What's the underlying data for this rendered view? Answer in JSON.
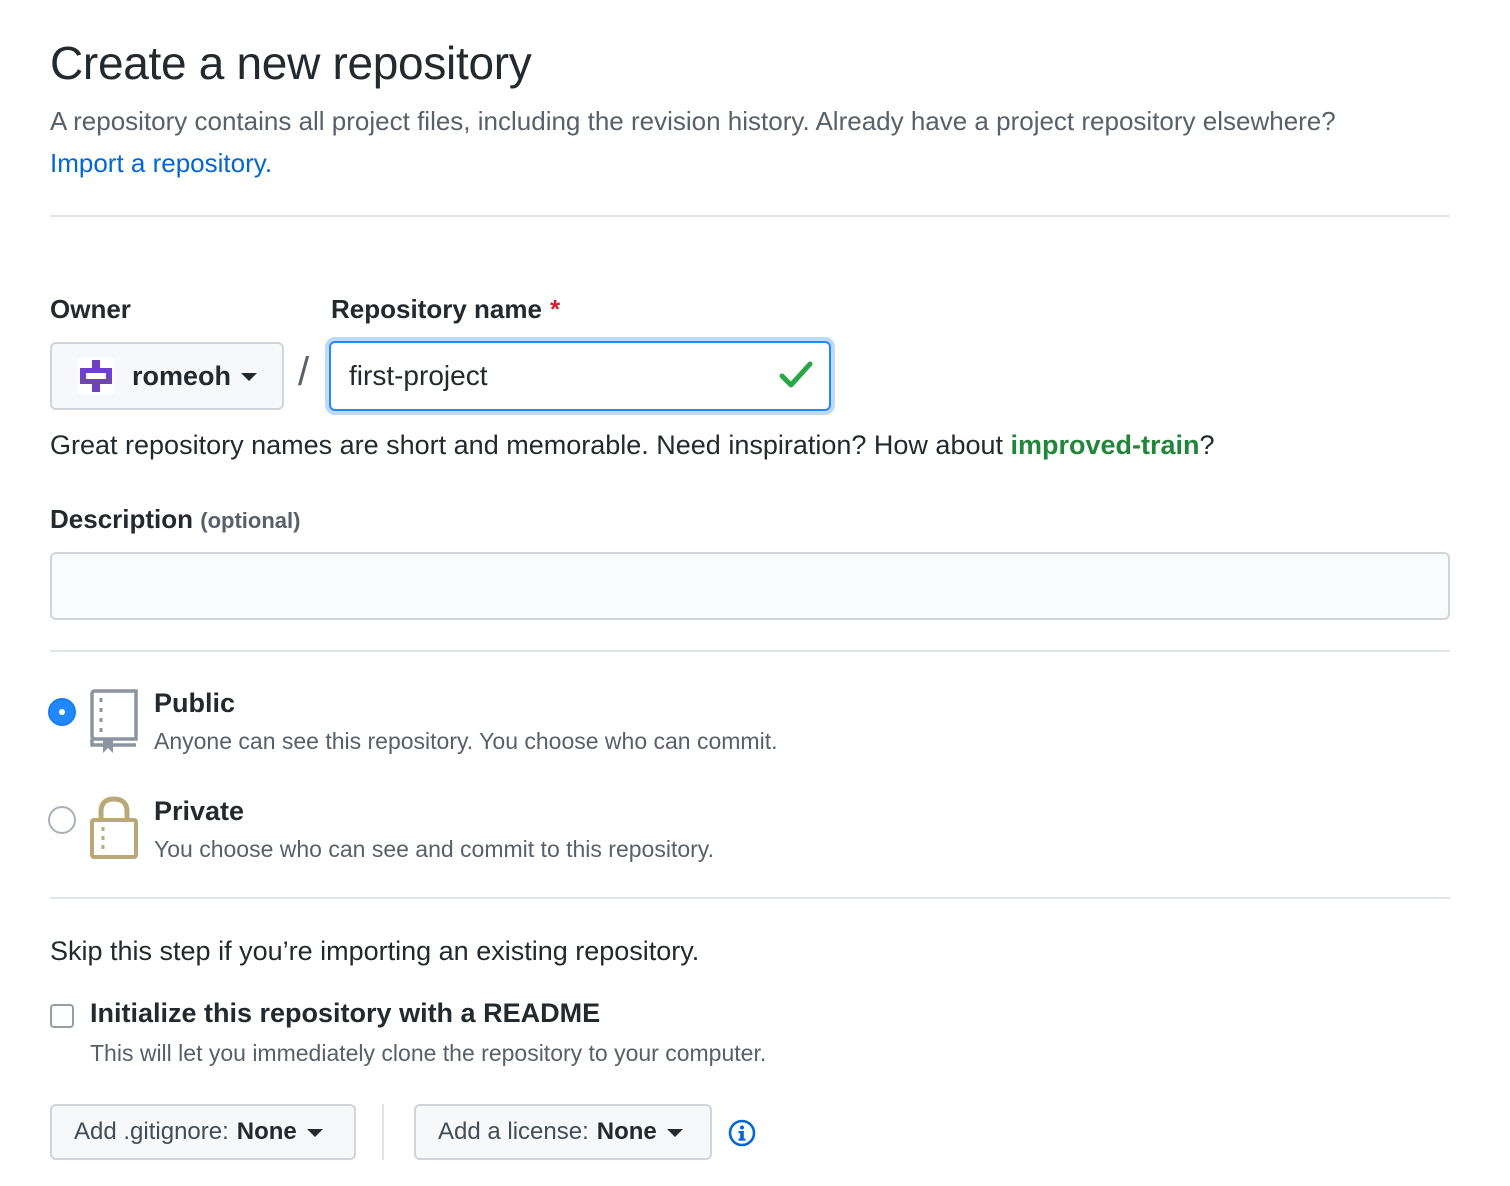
{
  "header": {
    "title": "Create a new repository",
    "intro": "A repository contains all project files, including the revision history. Already have a project repository elsewhere?",
    "import_link": "Import a repository."
  },
  "owner": {
    "label": "Owner",
    "value": "romeoh",
    "avatar_color": "#6f42c1"
  },
  "slash": "/",
  "repo_name": {
    "label": "Repository name",
    "required_mark": "*",
    "value": "first-project",
    "valid_icon": "check-icon",
    "valid_color": "#28a745"
  },
  "hint": {
    "prefix": "Great repository names are short and memorable. Need inspiration? How about",
    "suggestion": "improved-train",
    "suffix": "?"
  },
  "description": {
    "label": "Description",
    "optional": "(optional)",
    "value": ""
  },
  "visibility": {
    "options": [
      {
        "title": "Public",
        "desc": "Anyone can see this repository. You choose who can commit.",
        "icon": "repo-book-icon",
        "selected": true
      },
      {
        "title": "Private",
        "desc": "You choose who can see and commit to this repository.",
        "icon": "lock-icon",
        "selected": false
      }
    ]
  },
  "init": {
    "skip_text": "Skip this step if you’re importing an existing repository.",
    "readme_label": "Initialize this repository with a README",
    "readme_desc": "This will let you immediately clone the repository to your computer.",
    "readme_checked": false
  },
  "selectors": {
    "gitignore_label": "Add .gitignore:",
    "gitignore_value": "None",
    "license_label": "Add a license:",
    "license_value": "None",
    "info_icon": "info-icon"
  }
}
